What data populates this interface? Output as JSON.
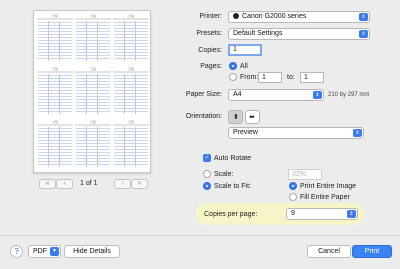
{
  "preview": {
    "page_indicator": "1 of 1",
    "nav": [
      "«",
      "‹",
      "›",
      "»"
    ],
    "header_texts": [
      "日程",
      "日程",
      "日程"
    ]
  },
  "printer": {
    "label": "Printer:",
    "value": "Canon G2000 series"
  },
  "presets": {
    "label": "Presets:",
    "value": "Default Settings"
  },
  "copies": {
    "label": "Copies:",
    "value": "1"
  },
  "pages": {
    "label": "Pages:",
    "all_label": "All",
    "from_label": "From:",
    "from_value": "1",
    "to_label": "to:",
    "to_value": "1"
  },
  "paper_size": {
    "label": "Paper Size:",
    "value": "A4",
    "dimensions": "210 by 297 mm"
  },
  "orientation": {
    "label": "Orientation:"
  },
  "section": {
    "value": "Preview"
  },
  "auto_rotate": {
    "label": "Auto Rotate",
    "checked": true
  },
  "scale": {
    "label": "Scale:",
    "value": "32%"
  },
  "scale_to_fit": {
    "label": "Scale to Fit:",
    "option1": "Print Entire Image",
    "option2": "Fill Entire Paper"
  },
  "copies_per_page": {
    "label": "Copies per page:",
    "value": "9"
  },
  "footer": {
    "help": "?",
    "pdf": "PDF",
    "hide_details": "Hide Details",
    "cancel": "Cancel",
    "print": "Print"
  },
  "colors": {
    "accent": "#3a7cf0",
    "highlight": "#f7f5c8"
  }
}
